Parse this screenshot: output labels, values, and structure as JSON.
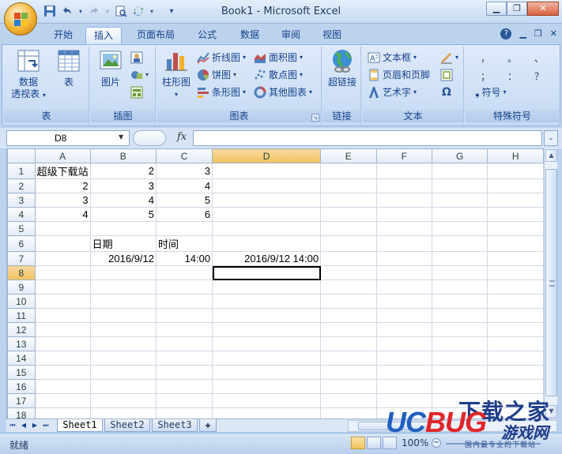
{
  "window": {
    "title": "Book1 - Microsoft Excel"
  },
  "qat": {
    "save": "save-icon",
    "undo": "undo-icon",
    "redo": "redo-icon",
    "print_preview": "print-preview-icon",
    "customize": "▾"
  },
  "tabs": [
    "开始",
    "插入",
    "页面布局",
    "公式",
    "数据",
    "审阅",
    "视图"
  ],
  "active_tab": "插入",
  "ribbon": {
    "groups": {
      "tables": {
        "label": "表",
        "pivot": "数据\n透视表",
        "pivot_line1": "数据",
        "pivot_line2": "透视表",
        "table": "表"
      },
      "illustrations": {
        "label": "插图",
        "picture": "图片"
      },
      "charts": {
        "label": "图表",
        "column": "柱形图",
        "line": "折线图",
        "pie": "饼图",
        "bar": "条形图",
        "area": "面积图",
        "scatter": "散点图",
        "other": "其他图表"
      },
      "links": {
        "label": "链接",
        "hyperlink": "超链接"
      },
      "text": {
        "label": "文本",
        "textbox": "文本框",
        "header_footer": "页眉和页脚",
        "wordart": "艺术字"
      },
      "symbols": {
        "label": "特殊符号",
        "symbol": "符号",
        "chars": [
          "，",
          "。",
          "、",
          "；",
          "：",
          "？"
        ]
      }
    }
  },
  "formula_bar": {
    "name_box": "D8",
    "fx": "fx",
    "value": ""
  },
  "grid": {
    "columns": [
      "A",
      "B",
      "C",
      "D",
      "E",
      "F",
      "G",
      "H"
    ],
    "selected_column": "D",
    "selected_row": "8",
    "rows": [
      {
        "n": "1",
        "A": "超级下载站",
        "B": "2",
        "C": "3",
        "D": ""
      },
      {
        "n": "2",
        "A": "2",
        "B": "3",
        "C": "4",
        "D": ""
      },
      {
        "n": "3",
        "A": "3",
        "B": "4",
        "C": "5",
        "D": ""
      },
      {
        "n": "4",
        "A": "4",
        "B": "5",
        "C": "6",
        "D": ""
      },
      {
        "n": "5",
        "A": "",
        "B": "",
        "C": "",
        "D": ""
      },
      {
        "n": "6",
        "A": "",
        "B": "日期",
        "C": "时间",
        "D": ""
      },
      {
        "n": "7",
        "A": "",
        "B": "2016/9/12",
        "C": "14:00",
        "D": "2016/9/12 14:00"
      },
      {
        "n": "8",
        "A": "",
        "B": "",
        "C": "",
        "D": ""
      },
      {
        "n": "9"
      },
      {
        "n": "10"
      },
      {
        "n": "11"
      },
      {
        "n": "12"
      },
      {
        "n": "13"
      },
      {
        "n": "14"
      },
      {
        "n": "15"
      },
      {
        "n": "16"
      },
      {
        "n": "17"
      },
      {
        "n": "18"
      }
    ]
  },
  "sheets": [
    "Sheet1",
    "Sheet2",
    "Sheet3"
  ],
  "active_sheet": "Sheet1",
  "status": {
    "ready": "就绪",
    "zoom": "100%"
  },
  "watermark": {
    "brand_latin_1": "UC",
    "brand_latin_2": "BUG",
    "brand_cn_top": "下载之家",
    "brand_cn_bottom": "游戏网",
    "sub": "国内最专业的下载站"
  },
  "colors": {
    "accent": "#15428b",
    "ribbon": "#cfe0f6",
    "selected_header": "#f1c15f",
    "grid_line": "#d0d7e5"
  }
}
